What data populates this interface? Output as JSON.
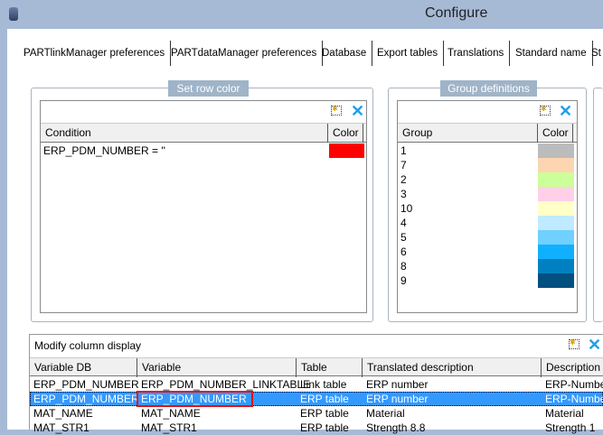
{
  "window": {
    "title": "Configure"
  },
  "tabs": [
    "PARTlinkManager preferences",
    "PARTdataManager preferences",
    "Database",
    "Export tables",
    "Translations",
    "Standard name",
    "St"
  ],
  "row_color": {
    "legend": "Set row color",
    "headers": [
      "Condition",
      "Color"
    ],
    "rows": [
      {
        "condition": "ERP_PDM_NUMBER = ''",
        "color": "#ff0000"
      }
    ]
  },
  "groups": {
    "legend": "Group definitions",
    "headers": [
      "Group",
      "Color"
    ],
    "rows": [
      {
        "group": "1",
        "color": "#bcbcbc"
      },
      {
        "group": "7",
        "color": "#fdd5b0"
      },
      {
        "group": "2",
        "color": "#ccff99"
      },
      {
        "group": "3",
        "color": "#ffd0e8"
      },
      {
        "group": "10",
        "color": "#ffffc8"
      },
      {
        "group": "4",
        "color": "#c0eaff"
      },
      {
        "group": "5",
        "color": "#70d0ff"
      },
      {
        "group": "6",
        "color": "#10b0ff"
      },
      {
        "group": "8",
        "color": "#0080c0"
      },
      {
        "group": "9",
        "color": "#005080"
      }
    ]
  },
  "columns": {
    "title": "Modify column display",
    "headers": [
      "Variable DB",
      "Variable",
      "Table",
      "Translated description",
      "Description"
    ],
    "rows": [
      [
        "ERP_PDM_NUMBER",
        "ERP_PDM_NUMBER_LINKTABLE",
        "Link table",
        "ERP number",
        "ERP-Number"
      ],
      [
        "ERP_PDM_NUMBER",
        "ERP_PDM_NUMBER",
        "ERP table",
        "ERP number",
        "ERP-Number"
      ],
      [
        "MAT_NAME",
        "MAT_NAME",
        "ERP table",
        "Material",
        "Material"
      ],
      [
        "MAT_STR1",
        "MAT_STR1",
        "ERP table",
        "Strength 8.8",
        "Strength 1"
      ]
    ],
    "selected_index": 1
  }
}
